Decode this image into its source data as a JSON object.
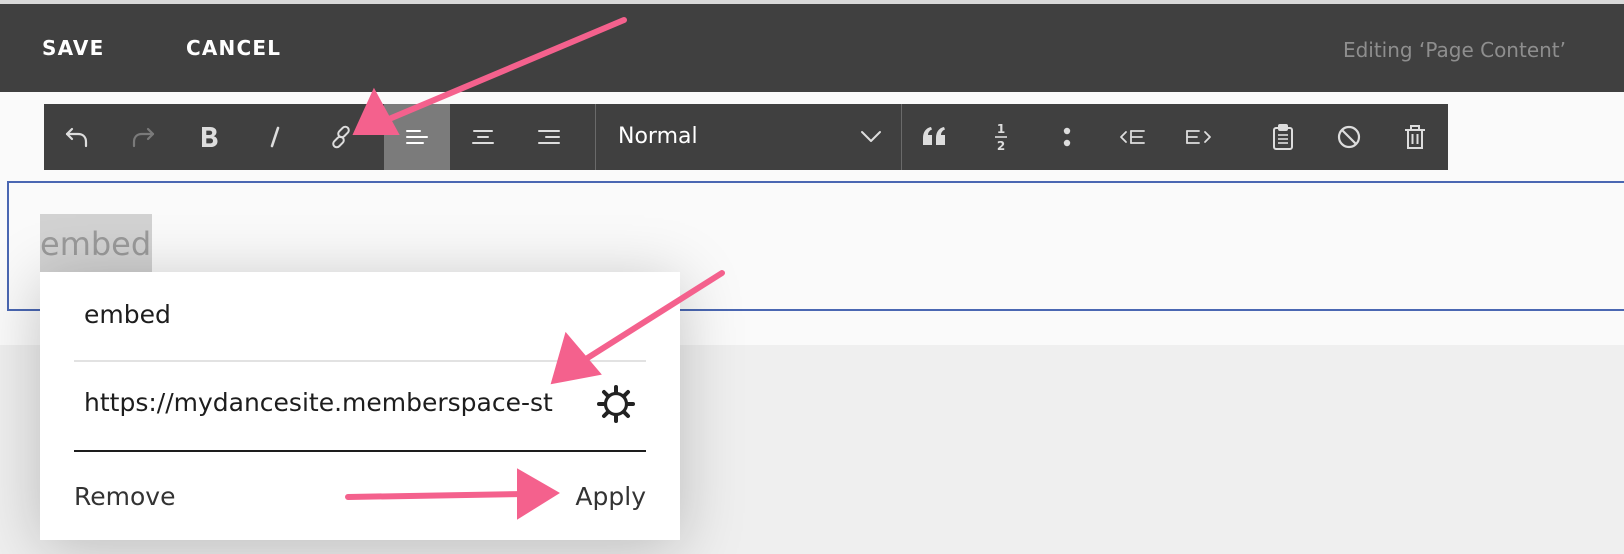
{
  "topbar": {
    "save_label": "SAVE",
    "cancel_label": "CANCEL",
    "editing_text": "Editing ‘Page Content’"
  },
  "toolbar": {
    "buttons": [
      {
        "icon": "undo-icon"
      },
      {
        "icon": "redo-icon",
        "state": "disabled"
      },
      {
        "icon": "bold-icon"
      },
      {
        "icon": "italic-icon"
      },
      {
        "icon": "link-icon"
      },
      {
        "icon": "align-left-icon",
        "state": "active"
      },
      {
        "icon": "align-center-icon"
      },
      {
        "icon": "align-right-icon"
      },
      {
        "icon": "blockquote-icon"
      },
      {
        "icon": "ordered-list-icon"
      },
      {
        "icon": "bulleted-list-icon"
      },
      {
        "icon": "outdent-icon"
      },
      {
        "icon": "indent-icon"
      },
      {
        "icon": "paste-icon"
      },
      {
        "icon": "clear-format-icon"
      },
      {
        "icon": "delete-icon"
      }
    ],
    "format_selected": "Normal",
    "ordered_list_glyph": {
      "top": "1",
      "bottom": "2"
    }
  },
  "editor": {
    "selected_text": "embed"
  },
  "link_popup": {
    "text_value": "embed",
    "url_value": "https://mydancesite.memberspace-st",
    "settings_icon": "gear-icon",
    "remove_label": "Remove",
    "apply_label": "Apply"
  },
  "annotations": {
    "arrow_color": "#f4618d",
    "arrows": [
      "points-to-link-icon",
      "points-to-url-field",
      "points-to-apply-button"
    ]
  }
}
